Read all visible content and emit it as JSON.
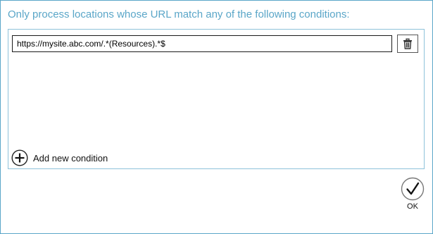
{
  "dialog": {
    "heading": "Only process locations whose URL match any of the following conditions:",
    "conditions": [
      {
        "value": "https://mysite.abc.com/.*(Resources).*$"
      }
    ],
    "add_condition_label": "Add new condition",
    "ok_label": "OK"
  },
  "icons": {
    "delete": "trash-icon",
    "add": "plus-circle-icon",
    "ok": "checkmark-circle-icon"
  },
  "colors": {
    "accent": "#5aa6c8",
    "panel_border": "#8ec2da"
  }
}
